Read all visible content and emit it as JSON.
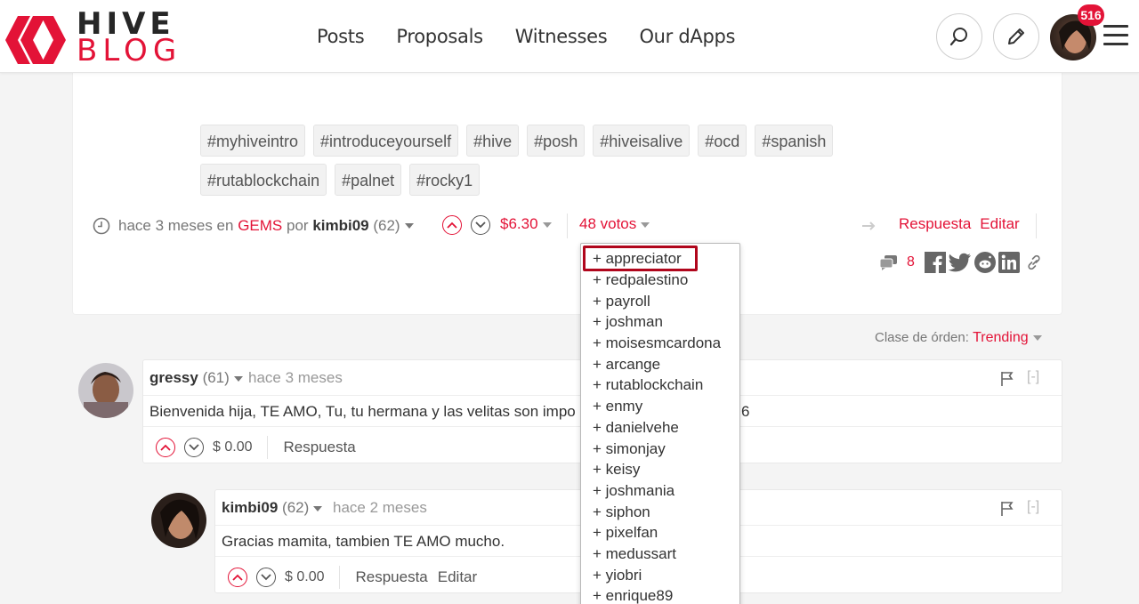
{
  "brand": {
    "line1": "HIVE",
    "line2": "BLOG",
    "color": "#e31337"
  },
  "nav": [
    "Posts",
    "Proposals",
    "Witnesses",
    "Our dApps"
  ],
  "header": {
    "notification_count": "516",
    "search_icon": "search-icon",
    "edit_icon": "pencil-icon",
    "menu_icon": "hamburger-icon"
  },
  "post": {
    "tags": [
      "#myhiveintro",
      "#introduceyourself",
      "#hive",
      "#posh",
      "#hiveisalive",
      "#ocd",
      "#spanish",
      "#rutablockchain",
      "#palnet",
      "#rocky1"
    ],
    "time": "hace 3 meses en",
    "community": "GEMS",
    "by": "por",
    "author": "kimbi09",
    "author_rep": "(62)",
    "payout": "$6.30",
    "votes": "48 votos",
    "reply": "Respuesta",
    "edit": "Editar",
    "comment_count": "8"
  },
  "sort": {
    "label": "Clase de órden:",
    "value": "Trending"
  },
  "voters": [
    "+ appreciator",
    "+ redpalestino",
    "+ payroll",
    "+ joshman",
    "+ moisesmcardona",
    "+ arcange",
    "+ rutablockchain",
    "+ enmy",
    "+ danielvehe",
    "+ simonjay",
    "+ keisy",
    "+ joshmania",
    "+ siphon",
    "+ pixelfan",
    "+ medussart",
    "+ yiobri",
    "+ enrique89"
  ],
  "comments": [
    {
      "user": "gressy",
      "rep": "(61)",
      "time": "hace 3 meses",
      "body": "Bienvenida hija, TE AMO, Tu, tu hermana y las velitas son impo",
      "body_tail": "6",
      "payout": "$ 0.00",
      "reply": "Respuesta",
      "collapse": "[-]"
    },
    {
      "user": "kimbi09",
      "rep": "(62)",
      "time": "hace 2 meses",
      "body": "Gracias mamita, tambien TE AMO mucho.",
      "payout": "$ 0.00",
      "reply": "Respuesta",
      "edit": "Editar",
      "collapse": "[-]"
    }
  ]
}
